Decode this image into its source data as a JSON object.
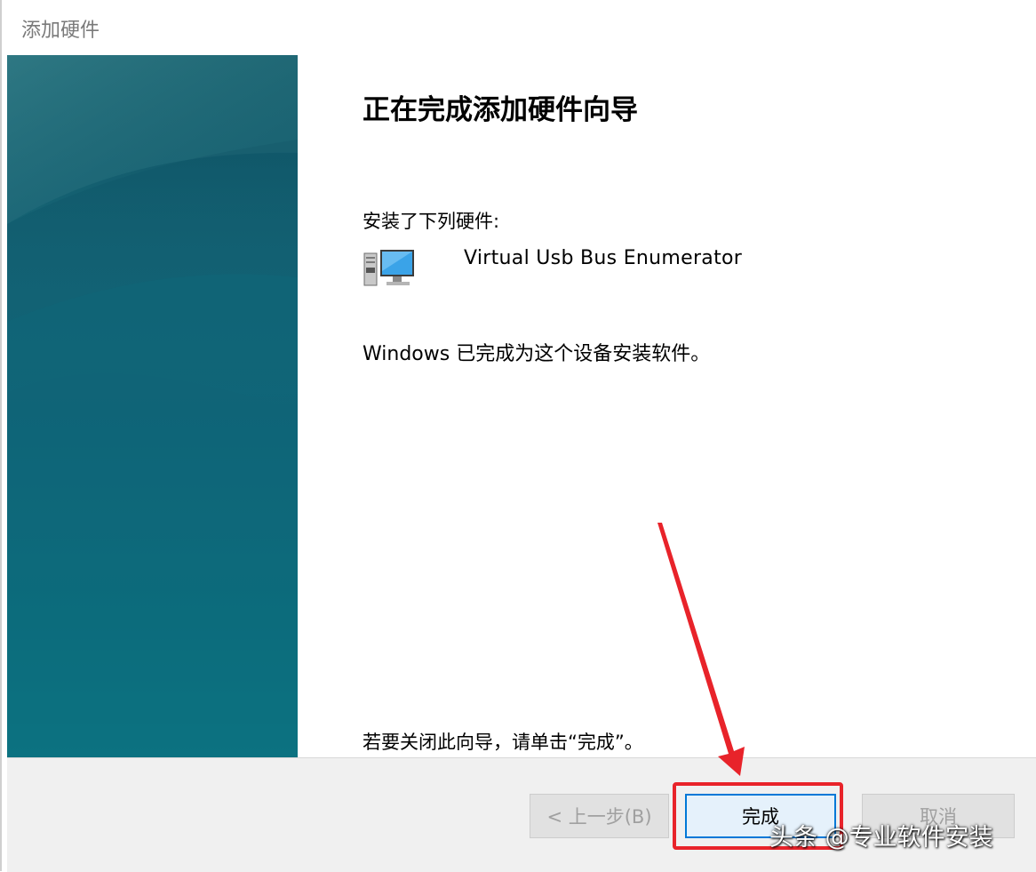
{
  "window": {
    "title": "添加硬件"
  },
  "content": {
    "heading": "正在完成添加硬件向导",
    "installed_label": "安装了下列硬件:",
    "device": {
      "name": "Virtual Usb Bus Enumerator",
      "icon": "computer-icon"
    },
    "done_message": "Windows 已完成为这个设备安装软件。",
    "close_hint": "若要关闭此向导，请单击“完成”。"
  },
  "buttons": {
    "back": "< 上一步(B)",
    "finish": "完成",
    "cancel": "取消"
  },
  "annotation": {
    "color": "#e8232a"
  },
  "watermark": "头条 @专业软件安装",
  "colors": {
    "sidebar": "#0f6377",
    "focus": "#0078d7"
  }
}
